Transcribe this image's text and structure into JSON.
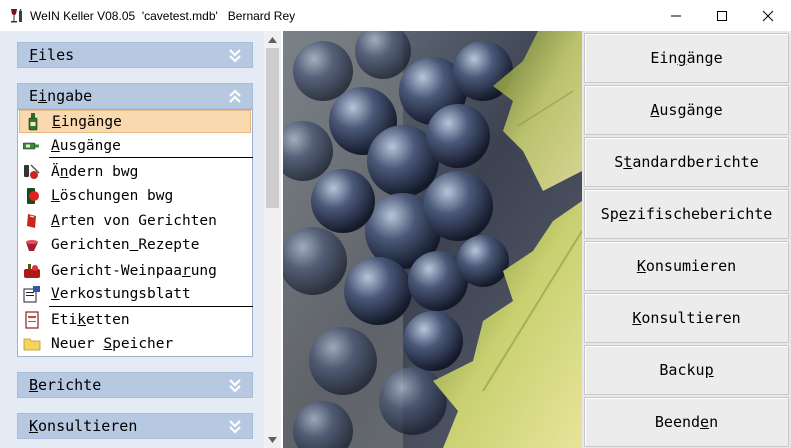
{
  "window": {
    "title": "WeIN Keller V08.05  'cavetest.mdb'   Bernard Rey",
    "minimize_icon": "minimize-icon",
    "maximize_icon": "maximize-icon",
    "close_icon": "close-icon"
  },
  "sidebar": {
    "groups": [
      {
        "label": "Files",
        "underline_index": 0,
        "state": "collapsed"
      },
      {
        "label": "Eingabe",
        "underline_index": 1,
        "state": "expanded"
      },
      {
        "label": "Berichte",
        "underline_index": 0,
        "state": "collapsed"
      },
      {
        "label": "Konsultieren",
        "underline_index": 0,
        "state": "collapsed"
      }
    ],
    "items": [
      {
        "label": "Eingänge",
        "underline_index": 0,
        "icon": "wine-bottle-icon",
        "selected": true
      },
      {
        "label": "Ausgänge",
        "underline_index": 0,
        "icon": "bottle-out-icon",
        "selected": false
      },
      {
        "label": "Ändern bwg",
        "underline_index": 1,
        "icon": "edit-bottle-icon",
        "selected": false
      },
      {
        "label": "Löschungen bwg",
        "underline_index": 0,
        "icon": "delete-bottle-icon",
        "selected": false
      },
      {
        "label": "Arten von Gerichten",
        "underline_index": 0,
        "icon": "dish-type-icon",
        "selected": false
      },
      {
        "label": "Gerichten Rezepte",
        "underline_index": 9,
        "icon": "recipe-icon",
        "selected": false
      },
      {
        "label": "Gericht-Weinpaarung",
        "underline_index": 15,
        "icon": "pairing-icon",
        "selected": false
      },
      {
        "label": "Verkostungsblatt",
        "underline_index": 0,
        "icon": "tasting-sheet-icon",
        "selected": false
      },
      {
        "label": "Etiketten",
        "underline_index": 3,
        "icon": "label-icon",
        "selected": false
      },
      {
        "label": "Neuer Speicher",
        "underline_index": 6,
        "icon": "folder-icon",
        "selected": false
      }
    ]
  },
  "buttons": [
    {
      "label": "Eingänge",
      "underline_index": 3
    },
    {
      "label": "Ausgänge",
      "underline_index": 0
    },
    {
      "label": "Standardberichte",
      "underline_index": 1
    },
    {
      "label": "Spezifischeberichte",
      "underline_index": 2
    },
    {
      "label": "Konsumieren",
      "underline_index": 0
    },
    {
      "label": "Konsultieren",
      "underline_index": 0
    },
    {
      "label": "Backup",
      "underline_index": 5
    },
    {
      "label": "Beenden",
      "underline_index": 5
    }
  ],
  "photo": {
    "icon": "grapes-image"
  },
  "colors": {
    "sidebar_bg": "#e4ebf4",
    "header_bg": "#b7c9e0",
    "selected_bg": "#fbd9ae"
  }
}
